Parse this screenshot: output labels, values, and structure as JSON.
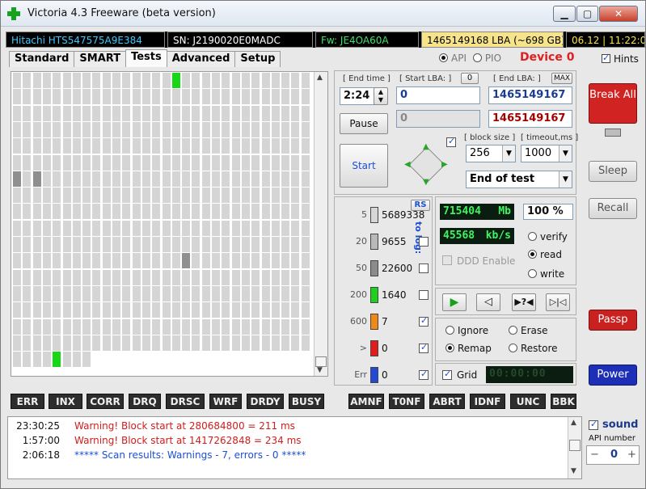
{
  "window": {
    "title": "Victoria 4.3 Freeware (beta version)",
    "minimize": "▁",
    "maximize": "▢",
    "close": "✕"
  },
  "drive": {
    "model": "Hitachi HTS547575A9E384",
    "serial": "SN: J2190020E0MADC",
    "firmware": "Fw: JE4OA60A",
    "lba": "1465149168 LBA (~698 GB)",
    "datetime": "06.12 | 11:22:0"
  },
  "tabs": [
    "Standard",
    "SMART",
    "Tests",
    "Advanced",
    "Setup"
  ],
  "mode": {
    "api": "API",
    "pio": "PIO",
    "device": "Device 0",
    "hints": "Hints"
  },
  "test": {
    "end_time_label": "[ End time ]",
    "end_time": "2:24",
    "start_lba_label": "[ Start LBA: ]",
    "start_lba_zero": "0",
    "start_lba": "0",
    "end_lba_label": "[ End LBA: ]",
    "end_lba_max": "MAX",
    "end_lba": "1465149167",
    "current_lba": "1465149167",
    "progress_field": "0",
    "pause": "Pause",
    "start": "Start",
    "block_size_label": "[ block size ]",
    "block_size": "256",
    "timeout_label": "[ timeout,ms ]",
    "timeout": "1000",
    "action": "End of test"
  },
  "stats": {
    "rs": "RS",
    "to_log": "to log:",
    "rows": [
      {
        "ms": "5",
        "count": "5689338",
        "color": "#d6d6d6"
      },
      {
        "ms": "20",
        "count": "9655",
        "color": "#b9b9b9"
      },
      {
        "ms": "50",
        "count": "22600",
        "color": "#8b8b8b"
      },
      {
        "ms": "200",
        "count": "1640",
        "color": "#1dd11d"
      },
      {
        "ms": "600",
        "count": "7",
        "color": "#f08a14"
      },
      {
        "ms": ">",
        "count": "0",
        "color": "#e21c1c"
      },
      {
        "ms": "Err",
        "count": "0",
        "color": "#2148d8"
      }
    ]
  },
  "readout": {
    "mb": "715404",
    "mb_unit": "Mb",
    "percent": "100",
    "percent_unit": "%",
    "speed": "45568",
    "speed_unit": "kb/s",
    "ddd": "DDD Enable",
    "verify": "verify",
    "read": "read",
    "write": "write",
    "ignore": "Ignore",
    "erase": "Erase",
    "remap": "Remap",
    "restore": "Restore",
    "grid": "Grid",
    "timer": "00:00:00"
  },
  "side": {
    "break": "Break All",
    "sleep": "Sleep",
    "recall": "Recall",
    "passp": "Passp",
    "power": "Power",
    "sound": "sound",
    "api_number_label": "API number",
    "api_number": "0",
    "minus": "−",
    "plus": "+"
  },
  "flags": [
    "ERR",
    "INX",
    "CORR",
    "DRQ",
    "DRSC",
    "WRF",
    "DRDY",
    "BUSY",
    "AMNF",
    "T0NF",
    "ABRT",
    "IDNF",
    "UNC",
    "BBK"
  ],
  "log": [
    {
      "time": "23:30:25",
      "msg": "Warning! Block start at 280684800 = 211 ms",
      "color": "#d21c1c"
    },
    {
      "time": "1:57:00",
      "msg": "Warning! Block start at 1417262848 = 234 ms",
      "color": "#d21c1c"
    },
    {
      "time": "2:06:18",
      "msg": "***** Scan results: Warnings - 7, errors - 0 *****",
      "color": "#1d4ed8"
    }
  ],
  "colors": {
    "green_block": "#16d816",
    "dark_block": "#8f8f8f"
  }
}
